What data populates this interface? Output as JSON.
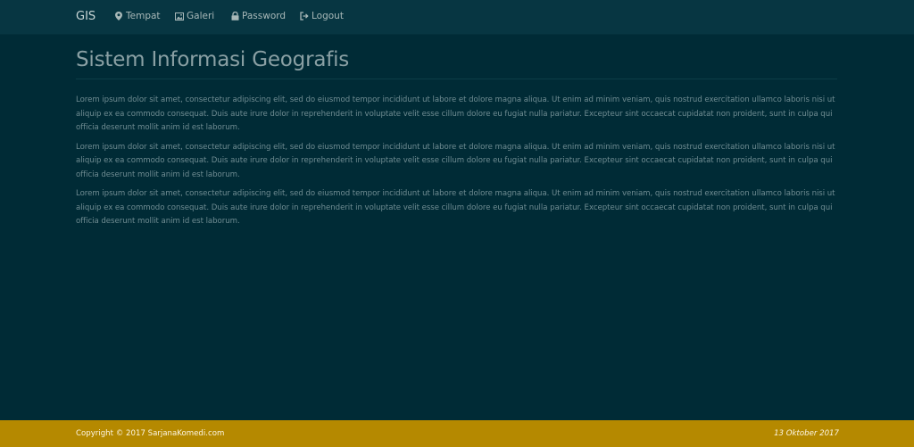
{
  "navbar": {
    "brand": "GIS",
    "items": [
      {
        "label": "Tempat",
        "icon": "map-marker-icon"
      },
      {
        "label": "Galeri",
        "icon": "picture-icon"
      },
      {
        "label": "Password",
        "icon": "lock-icon"
      },
      {
        "label": "Logout",
        "icon": "logout-icon"
      }
    ]
  },
  "main": {
    "title": "Sistem Informasi Geografis",
    "paragraphs": [
      "Lorem ipsum dolor sit amet, consectetur adipiscing elit, sed do eiusmod tempor incididunt ut labore et dolore magna aliqua. Ut enim ad minim veniam, quis nostrud exercitation ullamco laboris nisi ut aliquip ex ea commodo consequat. Duis aute irure dolor in reprehenderit in voluptate velit esse cillum dolore eu fugiat nulla pariatur. Excepteur sint occaecat cupidatat non proident, sunt in culpa qui officia deserunt mollit anim id est laborum.",
      "Lorem ipsum dolor sit amet, consectetur adipiscing elit, sed do eiusmod tempor incididunt ut labore et dolore magna aliqua. Ut enim ad minim veniam, quis nostrud exercitation ullamco laboris nisi ut aliquip ex ea commodo consequat. Duis aute irure dolor in reprehenderit in voluptate velit esse cillum dolore eu fugiat nulla pariatur. Excepteur sint occaecat cupidatat non proident, sunt in culpa qui officia deserunt mollit anim id est laborum.",
      "Lorem ipsum dolor sit amet, consectetur adipiscing elit, sed do eiusmod tempor incididunt ut labore et dolore magna aliqua. Ut enim ad minim veniam, quis nostrud exercitation ullamco laboris nisi ut aliquip ex ea commodo consequat. Duis aute irure dolor in reprehenderit in voluptate velit esse cillum dolore eu fugiat nulla pariatur. Excepteur sint occaecat cupidatat non proident, sunt in culpa qui officia deserunt mollit anim id est laborum."
    ]
  },
  "footer": {
    "copyright": "Copyright © 2017 SarjanaKomedi.com",
    "date": "13 Oktober 2017"
  },
  "colors": {
    "background": "#002b36",
    "navbar": "#073642",
    "footer": "#b58900"
  }
}
